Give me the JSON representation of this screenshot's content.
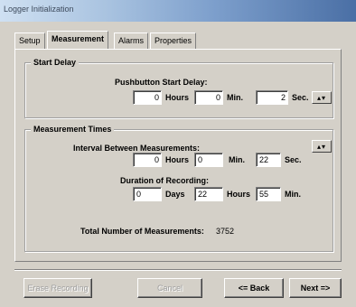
{
  "window": {
    "title": "Logger Initialization"
  },
  "tabs": [
    {
      "label": "Setup"
    },
    {
      "label": "Measurement"
    },
    {
      "label": "Alarms"
    },
    {
      "label": "Properties"
    }
  ],
  "start_delay": {
    "title": "Start Delay",
    "pushbutton_label": "Pushbutton Start Delay:",
    "hours_value": "0",
    "hours_unit": "Hours",
    "min_value": "0",
    "min_unit": "Min.",
    "sec_value": "2",
    "sec_unit": "Sec.",
    "spin_symbol": "▴▾"
  },
  "measurement_times": {
    "title": "Measurement Times",
    "interval_label": "Interval Between Measurements:",
    "interval": {
      "hours_value": "0",
      "hours_unit": "Hours",
      "min_value": "0",
      "min_unit": "Min.",
      "sec_value": "22",
      "sec_unit": "Sec."
    },
    "spin_symbol": "▴▾",
    "duration_label": "Duration of Recording:",
    "duration": {
      "days_value": "0",
      "days_unit": "Days",
      "hours_value": "22",
      "hours_unit": "Hours",
      "min_value": "55",
      "min_unit": "Min."
    },
    "total_label": "Total Number of Measurements:",
    "total_value": "3752"
  },
  "buttons": {
    "erase": "Erase Recording",
    "cancel": "Cancel",
    "back": "<= Back",
    "next": "Next =>"
  }
}
